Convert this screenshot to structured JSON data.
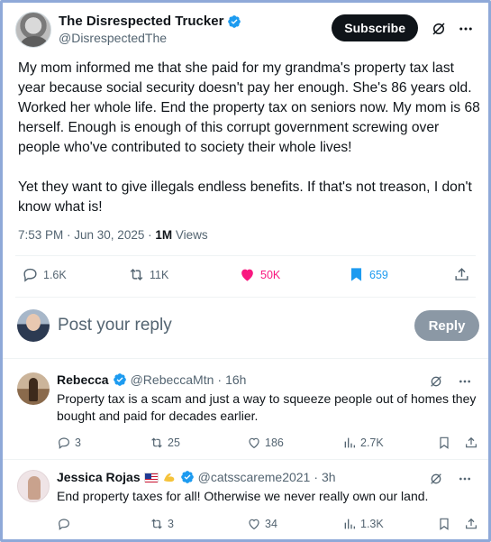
{
  "tweet": {
    "author": {
      "display_name": "The Disrespected Trucker",
      "handle": "@DisrespectedThe"
    },
    "subscribe_label": "Subscribe",
    "text": "My mom informed me that she paid for my grandma's property tax last year because social security doesn't pay her enough. She's 86 years old. Worked her whole life. End the property tax on seniors now. My mom is 68 herself. Enough is enough of this corrupt government screwing over people who've contributed to society their whole lives!\n\nYet they want to give illegals endless benefits. If that's not treason, I don't know what is!",
    "timestamp": "7:53 PM · Jun 30, 2025 · ",
    "views_count": "1M",
    "views_label": "Views",
    "stats": {
      "replies": "1.6K",
      "reposts": "11K",
      "likes": "50K",
      "bookmarks": "659"
    }
  },
  "reply_box": {
    "placeholder": "Post your reply",
    "button_label": "Reply"
  },
  "replies": [
    {
      "name": "Rebecca",
      "handle": "@RebeccaMtn",
      "dot": "·",
      "time": "16h",
      "text": "Property tax is a scam and just a way to squeeze people out of homes they bought and paid for decades earlier.",
      "replies": "3",
      "reposts": "25",
      "likes": "186",
      "views": "2.7K"
    },
    {
      "name": "Jessica Rojas",
      "handle": "@catsscareme2021",
      "dot": "·",
      "time": "3h",
      "text": "End property taxes for all! Otherwise we never really own our land.",
      "replies": "",
      "reposts": "3",
      "likes": "34",
      "views": "1.3K"
    }
  ],
  "colors": {
    "verified": "#1d9bf0",
    "like_active": "#f91880",
    "bookmark_active": "#1d9bf0",
    "secondary_text": "#536471",
    "frame_border": "#8fa9d8"
  }
}
